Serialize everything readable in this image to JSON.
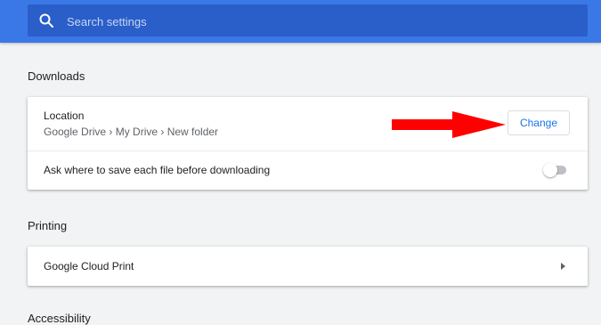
{
  "search": {
    "placeholder": "Search settings",
    "value": ""
  },
  "downloads": {
    "section_title": "Downloads",
    "location_label": "Location",
    "location_value": "Google Drive › My Drive › New folder",
    "change_label": "Change",
    "ask_label": "Ask where to save each file before downloading",
    "ask_enabled": false
  },
  "printing": {
    "section_title": "Printing",
    "cloud_print_label": "Google Cloud Print"
  },
  "accessibility": {
    "section_title": "Accessibility"
  },
  "colors": {
    "header": "#3b78e7",
    "search_bg": "#2a5ec8",
    "accent": "#1a73e8",
    "annotation_arrow": "#ff0000"
  },
  "icons": {
    "search": "search-icon",
    "row_arrow": "chevron-right-icon"
  }
}
